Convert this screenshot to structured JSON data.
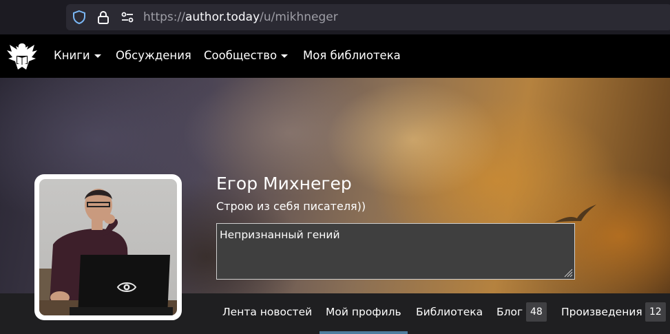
{
  "browser": {
    "url_scheme": "https://",
    "url_host": "author.today",
    "url_path": "/u/mikhneger"
  },
  "nav": {
    "items": [
      "Книги",
      "Обсуждения",
      "Сообщество",
      "Моя библиотека"
    ]
  },
  "profile": {
    "name": "Егор Михнегер",
    "tagline": "Строю из себя писателя))",
    "status": "Непризнанный гений"
  },
  "tabs": {
    "feed": "Лента новостей",
    "profile": "Мой профиль",
    "library": "Библиотека",
    "blog": "Блог",
    "blog_count": "48",
    "works": "Произведения",
    "works_count": "12"
  },
  "colors": {
    "active_tab_underline": "#4e7d9e",
    "navbar": "#000000"
  }
}
